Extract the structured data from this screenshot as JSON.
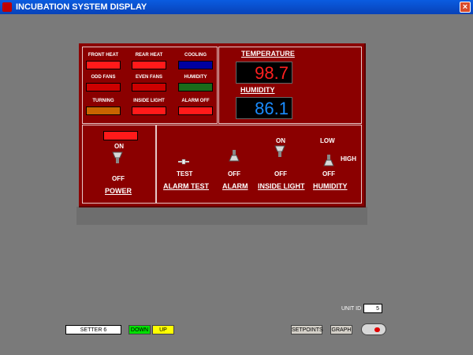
{
  "window": {
    "title": "INCUBATION SYSTEM DISPLAY",
    "close_glyph": "×"
  },
  "indicators": [
    {
      "label": "FRONT HEAT",
      "color": "#ff1a1a"
    },
    {
      "label": "REAR HEAT",
      "color": "#ff1a1a"
    },
    {
      "label": "COOLING",
      "color": "#0000a0"
    },
    {
      "label": "ODD FANS",
      "color": "#cc0000"
    },
    {
      "label": "EVEN FANS",
      "color": "#cc0000"
    },
    {
      "label": "HUMIDITY",
      "color": "#1a6b1a"
    },
    {
      "label": "TURNING",
      "color": "#c86400"
    },
    {
      "label": "INSIDE LIGHT",
      "color": "#ff1a1a"
    },
    {
      "label": "ALARM OFF",
      "color": "#ff1a1a"
    }
  ],
  "temperature": {
    "label": "TEMPERATURE",
    "value": "98.7",
    "color": "#ff2020"
  },
  "humidity": {
    "label": "HUMIDITY",
    "value": "86.1",
    "color": "#1a8cff"
  },
  "power": {
    "on_label": "ON",
    "off_label": "OFF",
    "title": "POWER",
    "indicator_color": "#ff1a1a"
  },
  "controls": {
    "alarm_test": {
      "state_label": "TEST",
      "title": "ALARM TEST"
    },
    "alarm": {
      "state_label": "OFF",
      "title": "ALARM"
    },
    "inside_light": {
      "on_label": "ON",
      "off_label": "OFF",
      "title": "INSIDE LIGHT"
    },
    "humidity": {
      "low_label": "LOW",
      "high_label": "HIGH",
      "off_label": "OFF",
      "title": "HUMIDITY"
    }
  },
  "unit_id": {
    "label": "UNIT ID",
    "value": "5"
  },
  "setter": {
    "value": "SETTER 6",
    "down_label": "DOWN",
    "up_label": "UP"
  },
  "buttons": {
    "setpoints": "SETPOINTS",
    "graph": "GRAPH"
  }
}
